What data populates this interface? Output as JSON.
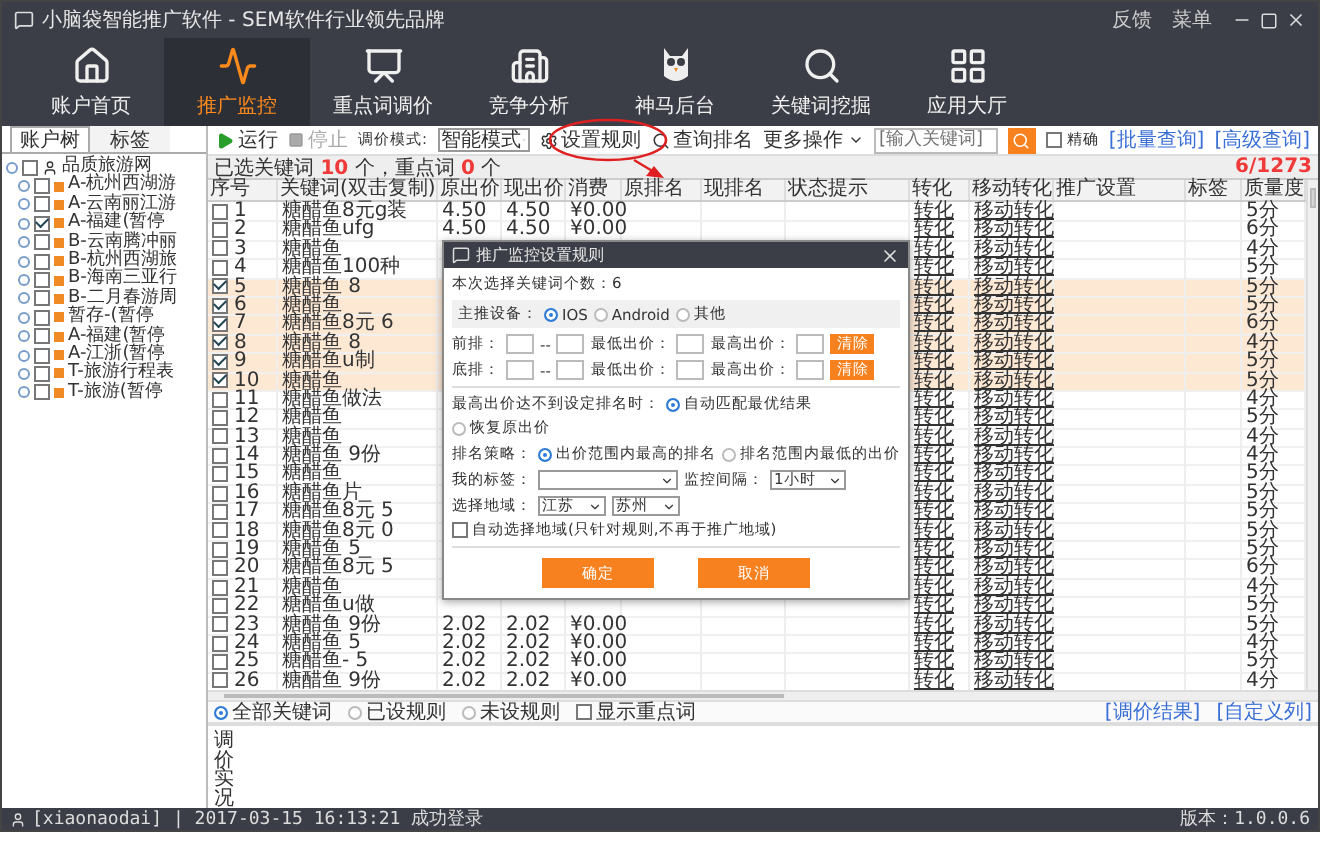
{
  "window": {
    "title": "小脑袋智能推广软件 - SEM软件行业领先品牌",
    "links": [
      "反馈",
      "菜单"
    ]
  },
  "nav": [
    {
      "label": "账户首页",
      "selected": false
    },
    {
      "label": "推广监控",
      "selected": true
    },
    {
      "label": "重点词调价",
      "selected": false
    },
    {
      "label": "竞争分析",
      "selected": false
    },
    {
      "label": "神马后台",
      "selected": false
    },
    {
      "label": "关键词挖掘",
      "selected": false
    },
    {
      "label": "应用大厅",
      "selected": false
    }
  ],
  "left_tabs": [
    {
      "label": "账户树",
      "selected": true
    },
    {
      "label": "标签",
      "selected": false
    }
  ],
  "tree": {
    "label": "品质旅游网",
    "checked": false,
    "children": [
      {
        "label": "A-杭州西湖游",
        "checked": false
      },
      {
        "label": "A-云南丽江游",
        "checked": false
      },
      {
        "label": "A-福建(暂停",
        "checked": true
      },
      {
        "label": "B-云南腾冲丽",
        "checked": false
      },
      {
        "label": "B-杭州西湖旅",
        "checked": false
      },
      {
        "label": "B-海南三亚行",
        "checked": false
      },
      {
        "label": "B-二月春游周",
        "checked": false
      },
      {
        "label": "暂存-(暂停",
        "checked": false
      },
      {
        "label": "A-福建(暂停",
        "checked": false
      },
      {
        "label": "A-江浙(暂停",
        "checked": false
      },
      {
        "label": "T-旅游行程表",
        "checked": false
      },
      {
        "label": "T-旅游(暂停",
        "checked": false
      }
    ]
  },
  "toolbar": {
    "run": "运行",
    "stop": {
      "label": "停止",
      "disabled": true
    },
    "mode_label": "调价模式:",
    "mode_value": "智能模式",
    "rule_button": "设置规则",
    "rank_button": "查询排名",
    "more_button": "更多操作",
    "search_placeholder": "[输入关键词]",
    "exact": {
      "label": "精确",
      "checked": false
    },
    "links": [
      "[批量查询]",
      "[高级查询]"
    ]
  },
  "summary": {
    "prefix": "已选关键词",
    "selected_count": "10",
    "middle": "个，重点词",
    "key_count": "0",
    "suffix": "个",
    "page": "6/1273"
  },
  "table": {
    "columns": [
      "序号",
      "关键词(双击复制)",
      "原出价",
      "现出价",
      "消费",
      "原排名",
      "现排名",
      "状态提示",
      "转化",
      "移动转化",
      "推广设置",
      "标签",
      "质量度"
    ],
    "rows": [
      {
        "no": "1",
        "checked": false,
        "keyword": "糖醋鱼8元g装",
        "bid_old": "4.50",
        "bid_new": "4.50",
        "cost": "¥0.00",
        "conversion": "转化",
        "mobile": "移动转化",
        "quality": "5分"
      },
      {
        "no": "2",
        "checked": false,
        "keyword": "糖醋鱼ufg",
        "bid_old": "4.50",
        "bid_new": "4.50",
        "cost": "¥0.00",
        "conversion": "转化",
        "mobile": "移动转化",
        "quality": "6分"
      },
      {
        "no": "3",
        "checked": false,
        "keyword": "糖醋鱼",
        "conversion": "转化",
        "mobile": "移动转化",
        "quality": "4分"
      },
      {
        "no": "4",
        "checked": false,
        "keyword": "糖醋鱼100种",
        "conversion": "转化",
        "mobile": "移动转化",
        "quality": "5分"
      },
      {
        "no": "5",
        "checked": true,
        "keyword": "糖醋鱼 8",
        "conversion": "转化",
        "mobile": "移动转化",
        "quality": "5分"
      },
      {
        "no": "6",
        "checked": true,
        "keyword": "糖醋鱼",
        "conversion": "转化",
        "mobile": "移动转化",
        "quality": "5分"
      },
      {
        "no": "7",
        "checked": true,
        "keyword": "糖醋鱼8元 6",
        "conversion": "转化",
        "mobile": "移动转化",
        "quality": "6分"
      },
      {
        "no": "8",
        "checked": true,
        "keyword": "糖醋鱼 8",
        "conversion": "转化",
        "mobile": "移动转化",
        "quality": "4分"
      },
      {
        "no": "9",
        "checked": true,
        "keyword": "糖醋鱼u制",
        "conversion": "转化",
        "mobile": "移动转化",
        "quality": "5分"
      },
      {
        "no": "10",
        "checked": true,
        "keyword": "糖醋鱼",
        "conversion": "转化",
        "mobile": "移动转化",
        "quality": "5分"
      },
      {
        "no": "11",
        "checked": false,
        "keyword": "糖醋鱼做法",
        "conversion": "转化",
        "mobile": "移动转化",
        "quality": "4分"
      },
      {
        "no": "12",
        "checked": false,
        "keyword": "糖醋鱼",
        "conversion": "转化",
        "mobile": "移动转化",
        "quality": "5分"
      },
      {
        "no": "13",
        "checked": false,
        "keyword": "糖醋鱼",
        "conversion": "转化",
        "mobile": "移动转化",
        "quality": "4分"
      },
      {
        "no": "14",
        "checked": false,
        "keyword": "糖醋鱼 9份",
        "conversion": "转化",
        "mobile": "移动转化",
        "quality": "4分"
      },
      {
        "no": "15",
        "checked": false,
        "keyword": "糖醋鱼",
        "conversion": "转化",
        "mobile": "移动转化",
        "quality": "5分"
      },
      {
        "no": "16",
        "checked": false,
        "keyword": "糖醋鱼片",
        "conversion": "转化",
        "mobile": "移动转化",
        "quality": "5分"
      },
      {
        "no": "17",
        "checked": false,
        "keyword": "糖醋鱼8元 5",
        "conversion": "转化",
        "mobile": "移动转化",
        "quality": "5分"
      },
      {
        "no": "18",
        "checked": false,
        "keyword": "糖醋鱼8元 0",
        "conversion": "转化",
        "mobile": "移动转化",
        "quality": "5分"
      },
      {
        "no": "19",
        "checked": false,
        "keyword": "糖醋鱼 5",
        "conversion": "转化",
        "mobile": "移动转化",
        "quality": "5分"
      },
      {
        "no": "20",
        "checked": false,
        "keyword": "糖醋鱼8元 5",
        "conversion": "转化",
        "mobile": "移动转化",
        "quality": "6分"
      },
      {
        "no": "21",
        "checked": false,
        "keyword": "糖醋鱼",
        "conversion": "转化",
        "mobile": "移动转化",
        "quality": "4分"
      },
      {
        "no": "22",
        "checked": false,
        "keyword": "糖醋鱼u做",
        "conversion": "转化",
        "mobile": "移动转化",
        "quality": "5分"
      },
      {
        "no": "23",
        "checked": false,
        "keyword": "糖醋鱼 9份",
        "bid_old": "2.02",
        "bid_new": "2.02",
        "cost": "¥0.00",
        "conversion": "转化",
        "mobile": "移动转化",
        "quality": "5分"
      },
      {
        "no": "24",
        "checked": false,
        "keyword": "糖醋鱼 5",
        "bid_old": "2.02",
        "bid_new": "2.02",
        "cost": "¥0.00",
        "conversion": "转化",
        "mobile": "移动转化",
        "quality": "4分"
      },
      {
        "no": "25",
        "checked": false,
        "keyword": "糖醋鱼- 5",
        "bid_old": "2.02",
        "bid_new": "2.02",
        "cost": "¥0.00",
        "conversion": "转化",
        "mobile": "移动转化",
        "quality": "5分"
      },
      {
        "no": "26",
        "checked": false,
        "keyword": "糖醋鱼 9份",
        "bid_old": "2.02",
        "bid_new": "2.02",
        "cost": "¥0.00",
        "conversion": "转化",
        "mobile": "移动转化",
        "quality": "4分"
      }
    ]
  },
  "filter": {
    "options": [
      {
        "label": "全部关键词",
        "selected": true
      },
      {
        "label": "已设规则",
        "selected": false
      },
      {
        "label": "未设规则",
        "selected": false
      }
    ],
    "show_key": {
      "label": "显示重点词",
      "checked": false
    },
    "links": [
      "[调价结果]",
      "[自定义列]"
    ]
  },
  "notes_label": "调价实况",
  "status": {
    "text": "[xiaonaodai] | 2017-03-15 16:13:21 成功登录",
    "version": "版本：1.0.0.6"
  },
  "dialog": {
    "title": "推广监控设置规则",
    "count_text": "本次选择关键词个数：6",
    "device": {
      "label": "主推设备：",
      "options": [
        {
          "label": "IOS",
          "selected": true
        },
        {
          "label": "Android",
          "selected": false
        },
        {
          "label": "其他",
          "selected": false
        }
      ]
    },
    "ranges": [
      {
        "label": "前排：",
        "separator": "--",
        "min_label": "最低出价：",
        "max_label": "最高出价：",
        "button": "清除"
      },
      {
        "label": "底排：",
        "separator": "--",
        "min_label": "最低出价：",
        "max_label": "最高出价：",
        "button": "清除"
      }
    ],
    "fallback": {
      "label": "最高出价达不到设定排名时：",
      "options": [
        {
          "label": "自动匹配最优结果",
          "selected": true
        },
        {
          "label": "恢复原出价",
          "selected": false
        }
      ]
    },
    "strategy": {
      "label": "排名策略：",
      "options": [
        {
          "label": "出价范围内最高的排名",
          "selected": true
        },
        {
          "label": "排名范围内最低的出价",
          "selected": false
        }
      ]
    },
    "tag_label": "我的标签：",
    "interval": {
      "label": "监控间隔：",
      "value": "1小时"
    },
    "region": {
      "label": "选择地域：",
      "province": "江苏",
      "city": "苏州",
      "auto": {
        "label": "自动选择地域(只针对规则,不再于推广地域)",
        "checked": false
      }
    },
    "buttons": [
      "确定",
      "取消"
    ]
  }
}
